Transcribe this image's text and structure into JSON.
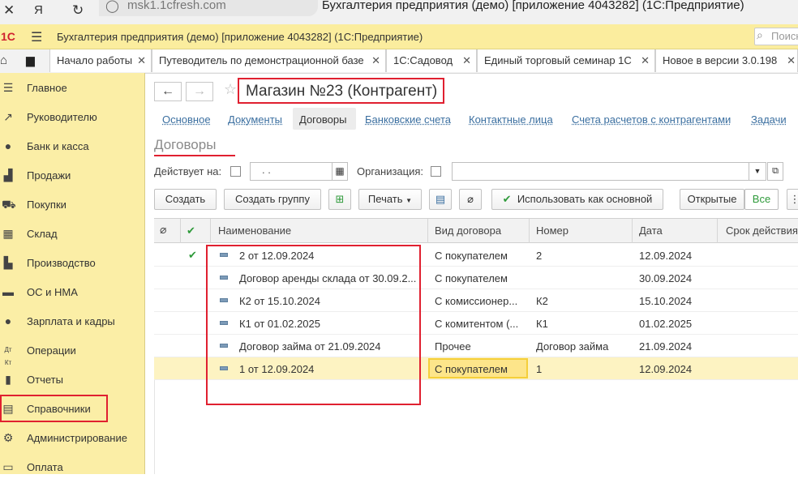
{
  "browser": {
    "url": "msk1.1cfresh.com",
    "window_title": "Бухгалтерия предприятия (демо) [приложение 4043282] (1С:Предприятие)"
  },
  "app": {
    "logo": "1С",
    "title": "Бухгалтерия предприятия (демо) [приложение 4043282]  (1С:Предприятие)",
    "search_placeholder": "Поиск"
  },
  "tabs": [
    {
      "label": "Начало работы"
    },
    {
      "label": "Путеводитель по демонстрационной базе"
    },
    {
      "label": "1С:Садовод"
    },
    {
      "label": "Единый торговый семинар 1С"
    },
    {
      "label": "Новое в версии 3.0.198"
    }
  ],
  "sidebar": {
    "items": [
      {
        "label": "Главное",
        "icon": "list-icon"
      },
      {
        "label": "Руководителю",
        "icon": "trend-icon"
      },
      {
        "label": "Банк и касса",
        "icon": "coin-icon"
      },
      {
        "label": "Продажи",
        "icon": "bag-icon"
      },
      {
        "label": "Покупки",
        "icon": "cart-icon"
      },
      {
        "label": "Склад",
        "icon": "warehouse-icon"
      },
      {
        "label": "Производство",
        "icon": "factory-icon"
      },
      {
        "label": "ОС и НМА",
        "icon": "truck-icon"
      },
      {
        "label": "Зарплата и кадры",
        "icon": "person-icon"
      },
      {
        "label": "Операции",
        "icon": "dt-kt-icon"
      },
      {
        "label": "Отчеты",
        "icon": "bar-chart-icon"
      },
      {
        "label": "Справочники",
        "icon": "book-icon"
      },
      {
        "label": "Администрирование",
        "icon": "gear-icon"
      },
      {
        "label": "Оплата",
        "icon": "payment-icon"
      }
    ]
  },
  "form": {
    "title": "Магазин №23 (Контрагент)",
    "sections": [
      "Основное",
      "Документы",
      "Договоры",
      "Банковские счета",
      "Контактные лица",
      "Счета расчетов с контрагентами",
      "Задачи"
    ],
    "section_title": "Договоры",
    "filter": {
      "active_label": "Действует на:",
      "date_value": " .  .",
      "org_label": "Организация:"
    },
    "toolbar": {
      "create": "Создать",
      "create_group": "Создать группу",
      "print": "Печать",
      "use_default": "Использовать как основной",
      "open": "Открытые",
      "all": "Все"
    },
    "table": {
      "columns": [
        "Наименование",
        "Вид договора",
        "Номер",
        "Дата",
        "Срок действия"
      ],
      "rows": [
        {
          "name": "2 от 12.09.2024",
          "kind": "С покупателем",
          "number": "2",
          "date": "12.09.2024",
          "default": "✔"
        },
        {
          "name": "Договор аренды склада от 30.09.2...",
          "kind": "С покупателем",
          "number": "",
          "date": "30.09.2024",
          "default": ""
        },
        {
          "name": "К2 от 15.10.2024",
          "kind": "С комиссионер...",
          "number": "К2",
          "date": "15.10.2024",
          "default": ""
        },
        {
          "name": "К1 от 01.02.2025",
          "kind": "С комитентом (...",
          "number": "К1",
          "date": "01.02.2025",
          "default": ""
        },
        {
          "name": "Договор займа от 21.09.2024",
          "kind": "Прочее",
          "number": "Договор займа",
          "date": "21.09.2024",
          "default": ""
        },
        {
          "name": "1 от 12.09.2024",
          "kind": "С покупателем",
          "number": "1",
          "date": "12.09.2024",
          "default": ""
        }
      ]
    }
  },
  "colors": {
    "accent_red": "#e02030",
    "sidebar_bg": "#fbeea6",
    "selected_row": "#fdf3c2",
    "link": "#3b6fa0",
    "green": "#2e9a3a"
  }
}
